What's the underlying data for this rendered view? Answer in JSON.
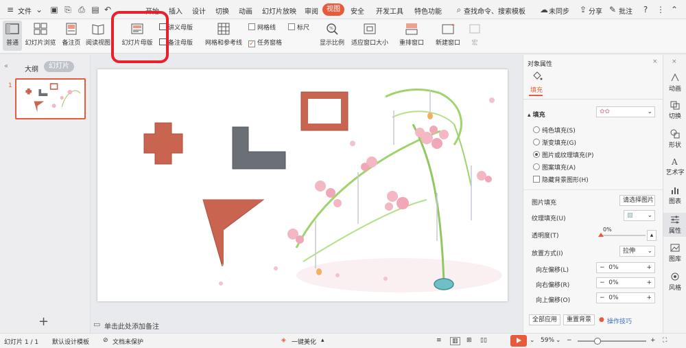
{
  "menu": {
    "file": "文件",
    "tabs": [
      "开始",
      "插入",
      "设计",
      "切换",
      "动画",
      "幻灯片放映",
      "审阅",
      "视图",
      "安全",
      "开发工具",
      "特色功能"
    ],
    "active_tab": "视图",
    "search": "查找命令、搜索模板",
    "sync": "未同步",
    "share": "分享",
    "comment": "批注"
  },
  "ribbon": {
    "normal": "普通",
    "slide_browse": "幻灯片浏览",
    "notes_page": "备注页",
    "reading_view": "阅读视图",
    "slide_master": "幻灯片母版",
    "handout_master": "讲义母版",
    "notes_master": "备注母版",
    "grid_guides": "网格和参考线",
    "gridlines": "网格线",
    "ruler": "标尺",
    "task_pane": "任务窗格",
    "zoom": "显示比例",
    "fit_window": "适应窗口大小",
    "arrange": "重排窗口",
    "new_window": "新建窗口",
    "macro": "宏"
  },
  "left_panel": {
    "outline_tab": "大纲",
    "slides_tab": "幻灯片",
    "slide_number": "1",
    "add": "+"
  },
  "notes_placeholder": "单击此处添加备注",
  "properties": {
    "title": "对象属性",
    "fill_tab": "填充",
    "fill_section": "填充",
    "options": [
      "纯色填充(S)",
      "渐变填充(G)",
      "图片或纹理填充(P)",
      "图案填充(A)"
    ],
    "selected_option": 2,
    "hide_bg": "隐藏背景图形(H)",
    "picture_fill": "图片填充",
    "picture_fill_value": "请选择图片",
    "texture_fill": "纹理填充(U)",
    "transparency": "透明度(T)",
    "transparency_value": "0%",
    "placement": "放置方式(I)",
    "placement_value": "拉伸",
    "left_offset": "向左偏移(L)",
    "left_offset_value": "0%",
    "right_offset": "向右偏移(R)",
    "right_offset_value": "0%",
    "top_offset": "向上偏移(O)",
    "top_offset_value": "0%",
    "apply_all": "全部应用",
    "reset_bg": "重置背景",
    "tips": "操作技巧"
  },
  "sidebar": [
    "动画",
    "切换",
    "形状",
    "艺术字",
    "图表",
    "属性",
    "图库",
    "风格"
  ],
  "status": {
    "slide_count": "幻灯片 1 / 1",
    "template": "默认设计模板",
    "protection": "文档未保护",
    "beautify": "一键美化",
    "zoom": "59%"
  },
  "colors": {
    "accent": "#e85a3c",
    "shape_fill": "#c96450",
    "gray_shape": "#6b6f76",
    "highlight": "#e8202a"
  }
}
